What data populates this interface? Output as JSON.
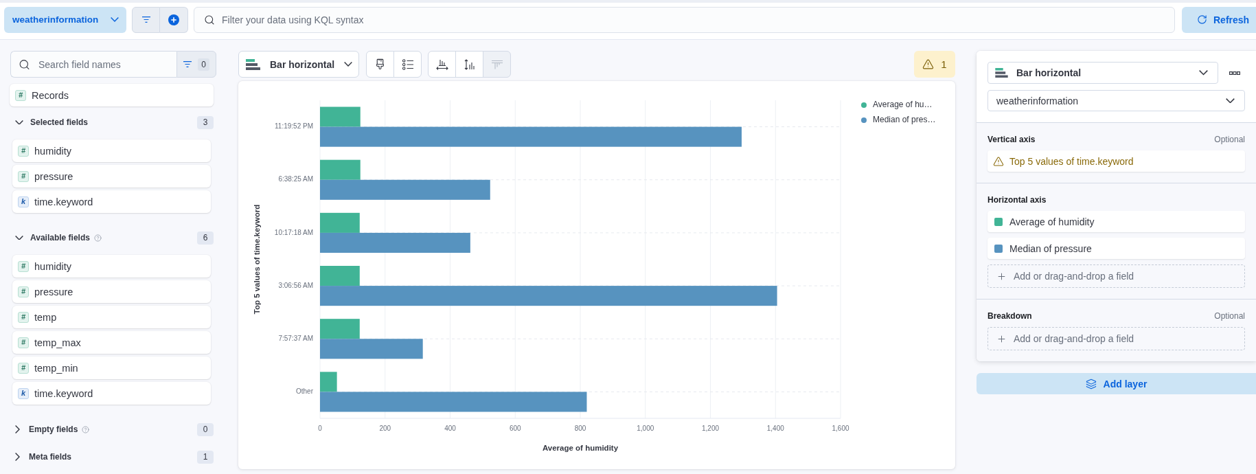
{
  "top_bar": {
    "data_view": "weatherinformation",
    "query": {
      "placeholder": "Filter your data using KQL syntax"
    },
    "refresh": "Refresh"
  },
  "field_list": {
    "search": {
      "placeholder": "Search field names"
    },
    "filter_count": "0",
    "records": {
      "kind": "number",
      "glyph": "#",
      "name": "Records"
    },
    "groups": [
      {
        "title": "Selected fields",
        "count": "3",
        "expanded": true,
        "help": false,
        "fields": [
          {
            "kind": "number",
            "glyph": "#",
            "name": "humidity"
          },
          {
            "kind": "number",
            "glyph": "#",
            "name": "pressure"
          },
          {
            "kind": "keyword",
            "glyph": "k",
            "name": "time.keyword"
          }
        ]
      },
      {
        "title": "Available fields",
        "count": "6",
        "expanded": true,
        "help": true,
        "fields": [
          {
            "kind": "number",
            "glyph": "#",
            "name": "humidity"
          },
          {
            "kind": "number",
            "glyph": "#",
            "name": "pressure"
          },
          {
            "kind": "number",
            "glyph": "#",
            "name": "temp"
          },
          {
            "kind": "number",
            "glyph": "#",
            "name": "temp_max"
          },
          {
            "kind": "number",
            "glyph": "#",
            "name": "temp_min"
          },
          {
            "kind": "keyword",
            "glyph": "k",
            "name": "time.keyword"
          }
        ]
      },
      {
        "title": "Empty fields",
        "count": "0",
        "expanded": false,
        "help": true
      },
      {
        "title": "Meta fields",
        "count": "1",
        "expanded": false,
        "help": false
      }
    ]
  },
  "workspace": {
    "chart_type": "Bar horizontal",
    "toolbar_groups": [
      [
        {
          "kind": "appearance",
          "disabled": false
        },
        {
          "kind": "legend",
          "disabled": false
        }
      ],
      [
        {
          "kind": "left-axis",
          "disabled": false
        },
        {
          "kind": "bottom-axis",
          "disabled": false
        },
        {
          "kind": "right-axis",
          "disabled": true
        }
      ]
    ],
    "warnings": "1",
    "chart_data": {
      "type": "bar",
      "orientation": "horizontal",
      "xlabel": "Average of humidity",
      "ylabel": "Top 5 values of time.keyword",
      "categories": [
        "11:19:52 PM",
        "6:38:25 AM",
        "10:17:18 AM",
        "3:06:56 AM",
        "7:57:37 AM",
        "Other"
      ],
      "series": [
        {
          "name": "Average of hu…",
          "color": "#41b496",
          "values": [
            124,
            124,
            122,
            122,
            122,
            52
          ]
        },
        {
          "name": "Median of pres…",
          "color": "#5793bf",
          "values": [
            1296,
            523,
            462,
            1405,
            316,
            820
          ]
        }
      ],
      "xlim": [
        0,
        1600
      ],
      "xticks": [
        {
          "value": 0,
          "label": "0"
        },
        {
          "value": 200,
          "label": "200"
        },
        {
          "value": 400,
          "label": "400"
        },
        {
          "value": 600,
          "label": "600"
        },
        {
          "value": 800,
          "label": "800"
        },
        {
          "value": 1000,
          "label": "1,000"
        },
        {
          "value": 1200,
          "label": "1,200"
        },
        {
          "value": 1400,
          "label": "1,400"
        },
        {
          "value": 1600,
          "label": "1,600"
        }
      ],
      "grid": true,
      "legend": "right"
    }
  },
  "layer_panel": {
    "chart_type": "Bar horizontal",
    "data_view": "weatherinformation",
    "sections": [
      {
        "title": "Vertical axis",
        "optional": "Optional",
        "items": [
          {
            "kind": "warning",
            "label": "Top 5 values of time.keyword"
          }
        ]
      },
      {
        "title": "Horizontal axis",
        "items": [
          {
            "kind": "metric",
            "label": "Average of humidity",
            "color": "#41b496"
          },
          {
            "kind": "metric",
            "label": "Median of pressure",
            "color": "#5793bf"
          },
          {
            "kind": "add",
            "label": "Add or drag-and-drop a field"
          }
        ]
      },
      {
        "title": "Breakdown",
        "optional": "Optional",
        "items": [
          {
            "kind": "add",
            "label": "Add or drag-and-drop a field"
          }
        ]
      }
    ],
    "add_layer": "Add layer"
  }
}
